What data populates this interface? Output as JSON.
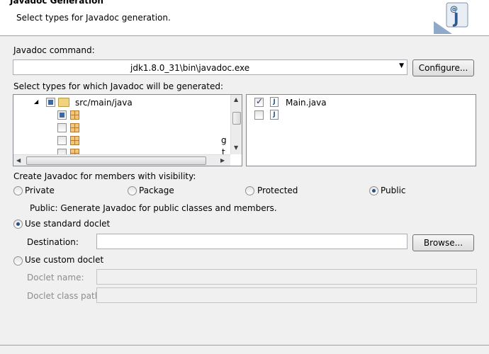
{
  "header": {
    "title": "Javadoc Generation",
    "description": "Select types for Javadoc generation."
  },
  "command": {
    "label": "Javadoc command:",
    "value": "jdk1.8.0_31\\bin\\javadoc.exe",
    "configure_label": "Configure..."
  },
  "types": {
    "label": "Select types for which Javadoc will be generated:",
    "tree_root": "src/main/java",
    "tree_children_partial": [
      "g",
      "t"
    ],
    "files": [
      {
        "name": "Main.java",
        "checked": true
      }
    ]
  },
  "visibility": {
    "label": "Create Javadoc for members with visibility:",
    "options": [
      "Private",
      "Package",
      "Protected",
      "Public"
    ],
    "selected": "Public",
    "description": "Public: Generate Javadoc for public classes and members."
  },
  "doclet": {
    "standard_label": "Use standard doclet",
    "destination_label": "Destination:",
    "browse_label": "Browse...",
    "custom_label": "Use custom doclet",
    "doclet_name_label": "Doclet name:",
    "doclet_class_path_label": "Doclet class path:",
    "selected": "standard"
  }
}
